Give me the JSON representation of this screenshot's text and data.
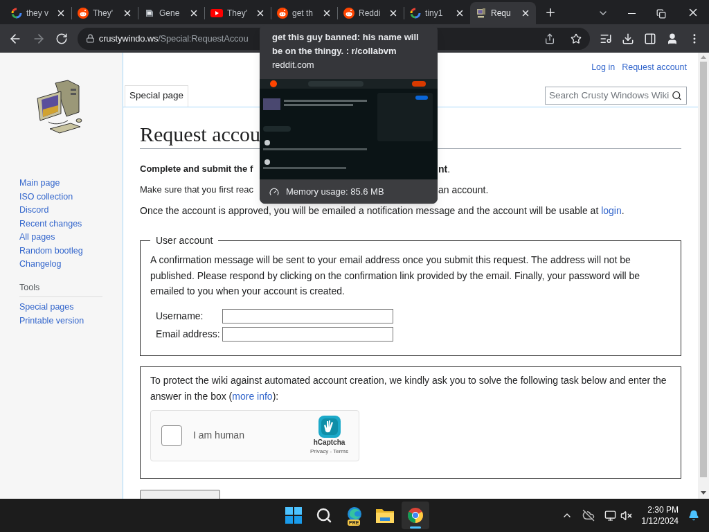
{
  "tabs": [
    {
      "title": "they v",
      "kind": "google",
      "selected": false
    },
    {
      "title": "They'",
      "kind": "reddit",
      "selected": false
    },
    {
      "title": "Gene",
      "kind": "gadget",
      "selected": false
    },
    {
      "title": "They'",
      "kind": "youtube",
      "selected": false
    },
    {
      "title": "get th",
      "kind": "reddit",
      "selected": false
    },
    {
      "title": "Reddi",
      "kind": "reddit",
      "selected": false
    },
    {
      "title": "tiny1",
      "kind": "google",
      "selected": false
    },
    {
      "title": "Requ",
      "kind": "computer",
      "selected": true
    }
  ],
  "toolbar": {
    "url_host": "crustywindo.ws",
    "url_path": "/Special:RequestAccou"
  },
  "tooltip": {
    "title": "get this guy banned: his name will be on the thingy. : r/collabvm",
    "domain": "reddit.com",
    "memory": "Memory usage: 85.6 MB"
  },
  "wiki": {
    "personal": [
      "Log in",
      "Request account"
    ],
    "nav": [
      "Main page",
      "ISO collection",
      "Discord",
      "Recent changes",
      "All pages",
      "Random bootleg",
      "Changelog"
    ],
    "tools_heading": "Tools",
    "tools": [
      "Special pages",
      "Printable version"
    ],
    "page_tab": "Special page",
    "search_placeholder": "Search Crusty Windows Wiki",
    "heading": "Request accou",
    "intro_lines": [
      [
        "**Complete and submit the f**",
        "**nt**."
      ],
      [
        "Make sure that you first reac",
        "an account."
      ]
    ],
    "approval": {
      "before": "Once the account is approved, you will be emailed a notification message and the account will be usable at ",
      "link": "login",
      "after": "."
    },
    "account_form": {
      "legend": "User account",
      "text": "A confirmation message will be sent to your email address once you submit this request. The address will not be published. Please respond by clicking on the confirmation link provided by the email. Finally, your password will be emailed to you when your account is created.",
      "fields": [
        {
          "label": "Username:"
        },
        {
          "label": "Email address:"
        }
      ]
    },
    "captcha": {
      "before": "To protect the wiki against automated account creation, we kindly ask you to solve the following task below and enter the answer in the box (",
      "link": "more info",
      "after": "):",
      "label": "I am human",
      "checked": false,
      "brand": "hCaptcha",
      "links": "Privacy - Terms"
    }
  },
  "taskbar": {
    "apps": [
      {
        "kind": "start",
        "active": false
      },
      {
        "kind": "search",
        "active": false
      },
      {
        "kind": "edge",
        "badge": "PRE",
        "active": false
      },
      {
        "kind": "explorer",
        "active": false
      },
      {
        "kind": "chrome",
        "active": true
      }
    ],
    "time": "2:30 PM",
    "date": "1/12/2024"
  }
}
